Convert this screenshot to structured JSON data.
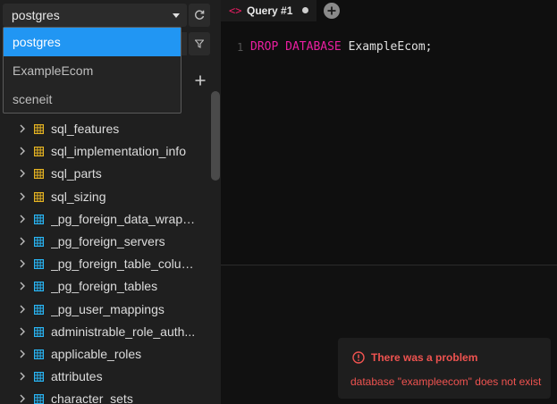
{
  "sidebar": {
    "db_select": {
      "value": "postgres"
    },
    "tables": [
      {
        "name": "sql_features",
        "kind": "system"
      },
      {
        "name": "sql_implementation_info",
        "kind": "system"
      },
      {
        "name": "sql_parts",
        "kind": "system"
      },
      {
        "name": "sql_sizing",
        "kind": "system"
      },
      {
        "name": "_pg_foreign_data_wrapp...",
        "kind": "view"
      },
      {
        "name": "_pg_foreign_servers",
        "kind": "view"
      },
      {
        "name": "_pg_foreign_table_colum...",
        "kind": "view"
      },
      {
        "name": "_pg_foreign_tables",
        "kind": "view"
      },
      {
        "name": "_pg_user_mappings",
        "kind": "view"
      },
      {
        "name": "administrable_role_auth...",
        "kind": "view"
      },
      {
        "name": "applicable_roles",
        "kind": "view"
      },
      {
        "name": "attributes",
        "kind": "view"
      },
      {
        "name": "character_sets",
        "kind": "view"
      }
    ]
  },
  "dropdown": {
    "options": [
      "postgres",
      "ExampleEcom",
      "sceneit"
    ],
    "selected": "postgres"
  },
  "tabs": [
    {
      "label": "Query #1",
      "unsaved": true
    }
  ],
  "editor": {
    "line_number": "1",
    "keyword1": "DROP",
    "keyword2": "DATABASE",
    "rest": " ExampleEcom;"
  },
  "toast": {
    "title": "There was a problem",
    "message": "database \"exampleecom\" does not exist"
  },
  "colors": {
    "accent": "#2196f3",
    "error": "#ef5350",
    "keyword": "#e91ea0",
    "system_table_icon": "#e6b422",
    "view_table_icon": "#29b6f6"
  }
}
